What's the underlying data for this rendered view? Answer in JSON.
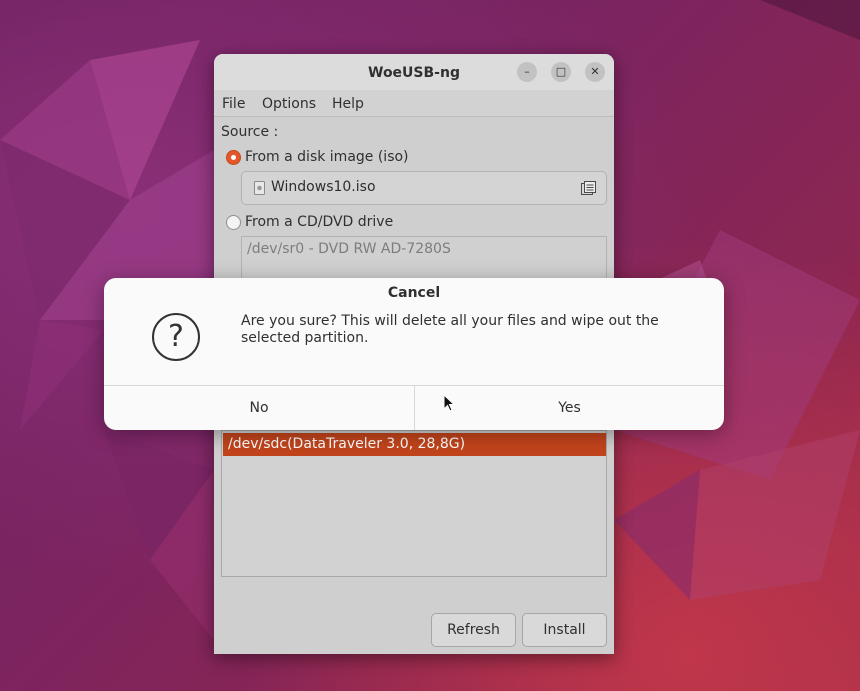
{
  "window": {
    "title": "WoeUSB-ng",
    "controls": {
      "minimize": "minimize-icon",
      "maximize": "maximize-icon",
      "close": "close-icon"
    }
  },
  "menu": [
    "File",
    "Options",
    "Help"
  ],
  "source": {
    "label": "Source :",
    "iso_option": "From a disk image (iso)",
    "iso_selected": true,
    "iso_file": "Windows10.iso",
    "cd_option": "From a CD/DVD drive",
    "cd_selected": false,
    "cd_drive": "/dev/sr0 - DVD RW AD-7280S"
  },
  "target": {
    "selected_device": "/dev/sdc(DataTraveler 3.0, 28,8G)"
  },
  "buttons": {
    "refresh": "Refresh",
    "install": "Install"
  },
  "dialog": {
    "title": "Cancel",
    "icon": "question-icon",
    "message": "Are you sure? This will delete all your files and wipe out the selected partition.",
    "no": "No",
    "yes": "Yes"
  },
  "colors": {
    "accent": "#e2582c",
    "selection": "#c2441c"
  }
}
